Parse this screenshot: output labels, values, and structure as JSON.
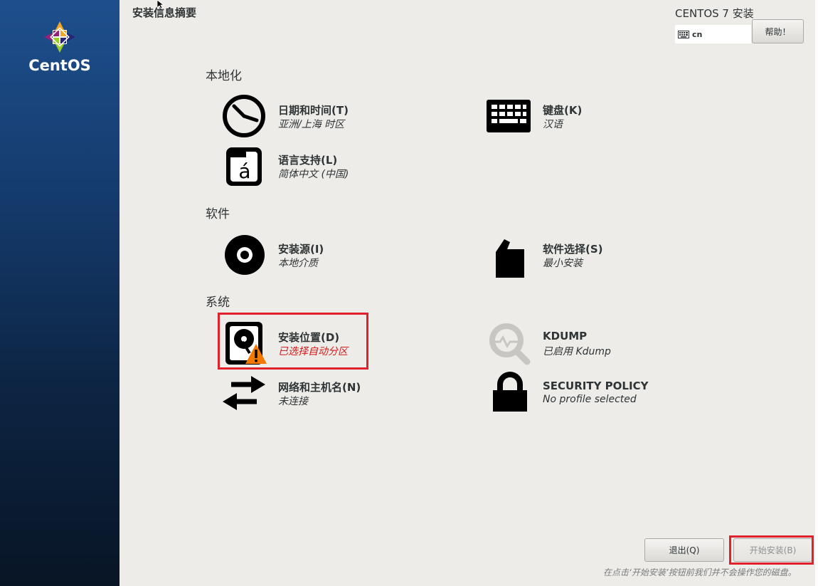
{
  "sidebar": {
    "logo_text": "CentOS"
  },
  "header": {
    "title": "安装信息摘要",
    "product": "CENTOS 7 安装",
    "keyboard_layout": "cn",
    "help_label": "帮助！"
  },
  "sections": {
    "localization": "本地化",
    "software": "软件",
    "system": "系统"
  },
  "spokes": {
    "datetime": {
      "title": "日期和时间(T)",
      "status": "亚洲/上海 时区"
    },
    "keyboard": {
      "title": "键盘(K)",
      "status": "汉语"
    },
    "language": {
      "title": "语言支持(L)",
      "status": "简体中文 (中国)"
    },
    "source": {
      "title": "安装源(I)",
      "status": "本地介质"
    },
    "software_selection": {
      "title": "软件选择(S)",
      "status": "最小安装"
    },
    "storage": {
      "title": "安装位置(D)",
      "status": "已选择自动分区"
    },
    "kdump": {
      "title": "KDUMP",
      "status": "已启用 Kdump"
    },
    "network": {
      "title": "网络和主机名(N)",
      "status": "未连接"
    },
    "security": {
      "title": "SECURITY POLICY",
      "status": "No profile selected"
    }
  },
  "footer": {
    "quit_label": "退出(Q)",
    "begin_label": "开始安装(B)",
    "note": "在点击‘开始安装’按钮前我们并不会操作您的磁盘。"
  },
  "colors": {
    "warning_text": "#d11a1a",
    "highlight_box": "#e0202a",
    "warning_icon": "#f57900"
  }
}
